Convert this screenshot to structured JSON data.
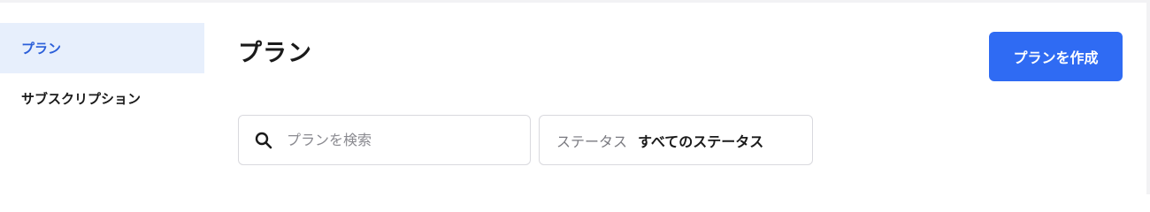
{
  "sidebar": {
    "items": [
      {
        "label": "プラン",
        "active": true
      },
      {
        "label": "サブスクリプション",
        "active": false
      }
    ]
  },
  "header": {
    "title": "プラン",
    "create_button_label": "プランを作成"
  },
  "search": {
    "placeholder": "プランを検索",
    "value": "",
    "icon": "search-icon"
  },
  "filter": {
    "label": "ステータス",
    "value": "すべてのステータス"
  },
  "colors": {
    "accent": "#2f6bf3",
    "active_nav_bg": "#e7effc",
    "active_nav_text": "#2b5fd9"
  }
}
